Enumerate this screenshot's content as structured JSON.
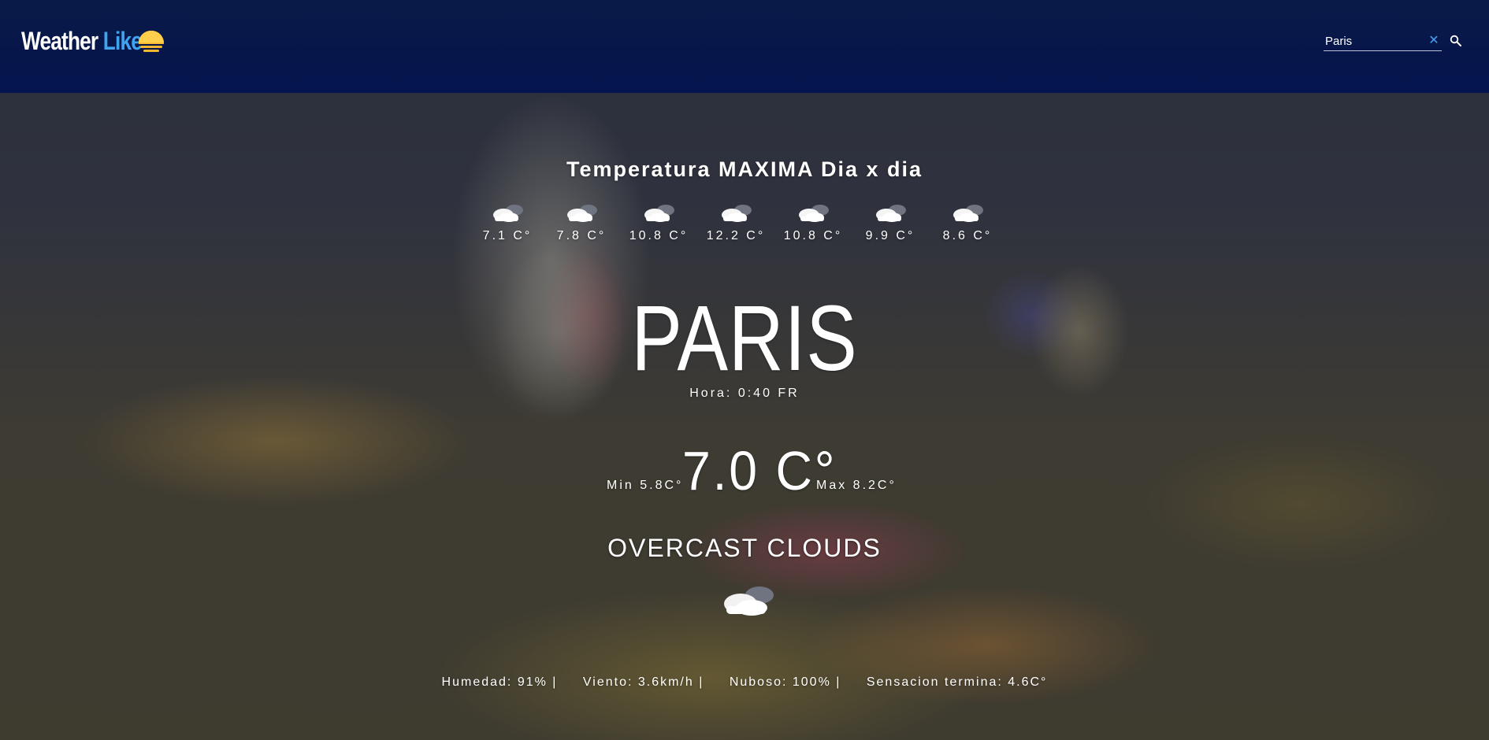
{
  "header": {
    "brand_part1": "Weather",
    "brand_part2": "Like",
    "search": {
      "value": "Paris",
      "placeholder": ""
    },
    "colors": {
      "background": "#06164a",
      "brand_accent": "#3fa3f0",
      "sun": "#f5b82e"
    }
  },
  "forecast": {
    "title": "Temperatura MAXIMA Dia x dia",
    "days": [
      {
        "temp": "7.1 C°",
        "icon": "cloud-icon"
      },
      {
        "temp": "7.8 C°",
        "icon": "cloud-icon"
      },
      {
        "temp": "10.8 C°",
        "icon": "cloud-icon"
      },
      {
        "temp": "12.2 C°",
        "icon": "cloud-icon"
      },
      {
        "temp": "10.8 C°",
        "icon": "cloud-icon"
      },
      {
        "temp": "9.9 C°",
        "icon": "cloud-icon"
      },
      {
        "temp": "8.6 C°",
        "icon": "cloud-icon"
      }
    ]
  },
  "current": {
    "city": "PARIS",
    "hora": "Hora: 0:40 FR",
    "min": "Min 5.8C°",
    "temp": "7.0 C°",
    "max": "Max 8.2C°",
    "description": "OVERCAST CLOUDS",
    "icon": "overcast-clouds-icon"
  },
  "stats": {
    "humedad": "Humedad: 91% |",
    "viento": "Viento: 3.6km/h |",
    "nuboso": "Nuboso: 100% |",
    "sensacion": "Sensacion termina: 4.6C°"
  }
}
